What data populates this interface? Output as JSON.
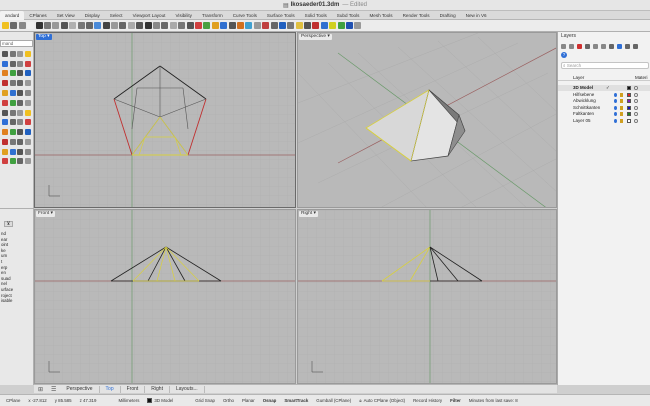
{
  "window": {
    "title": "Ikosaeder01.3dm",
    "edited": "— Edited"
  },
  "tabs": [
    "andard",
    "CPlanes",
    "Set View",
    "Display",
    "Select",
    "Viewport Layout",
    "Visibility",
    "Transform",
    "Curve Tools",
    "Surface Tools",
    "Solid Tools",
    "Subd Tools",
    "Mesh Tools",
    "Render Tools",
    "Drafting",
    "New in V6"
  ],
  "left_panel": {
    "search_placeholder": "mand",
    "commands": [
      "nd",
      "ear",
      "oint",
      "ke",
      "um",
      "t",
      "erp",
      "en",
      "suad",
      "nel",
      "urface",
      "roject",
      "",
      "isable"
    ]
  },
  "viewports": {
    "top": {
      "label": "Top"
    },
    "perspective": {
      "label": "Perspective"
    },
    "front": {
      "label": "Front"
    },
    "right": {
      "label": "Right"
    }
  },
  "layers_panel": {
    "title": "Layers",
    "search_placeholder": "Search",
    "column_layer": "Layer",
    "column_material": "Materi",
    "rows": [
      {
        "name": "3D Model",
        "current": true,
        "color": "#111111",
        "bold": true
      },
      {
        "name": "Hilfsebene",
        "color": "#e02020"
      },
      {
        "name": "Abwicklung",
        "color": "#8020c0"
      },
      {
        "name": "Schnittkanten",
        "color": "#1010c0"
      },
      {
        "name": "Faltkanten",
        "color": "#208020"
      },
      {
        "name": "Layer 05",
        "color": "#ffffff"
      }
    ]
  },
  "bottom_tabs": [
    "Perspective",
    "Top",
    "Front",
    "Right",
    "Layouts..."
  ],
  "bottom_tab_selected": "Top",
  "status": {
    "cplane": "CPlane",
    "x": "x -27.812",
    "y": "y 85.585",
    "z": "z 47.319",
    "units": "Millimeters",
    "layer": "3D Model",
    "grid_snap": "Grid Snap",
    "ortho": "Ortho",
    "planar": "Planar",
    "osnap": "Osnap",
    "smarttrack": "SmartTrack",
    "gumball": "Gumball (CPlane)",
    "auto_cplane": "Auto CPlane (Object)",
    "record_history": "Record History",
    "filter": "Filter",
    "minutes": "Minutes from last save: 8"
  }
}
